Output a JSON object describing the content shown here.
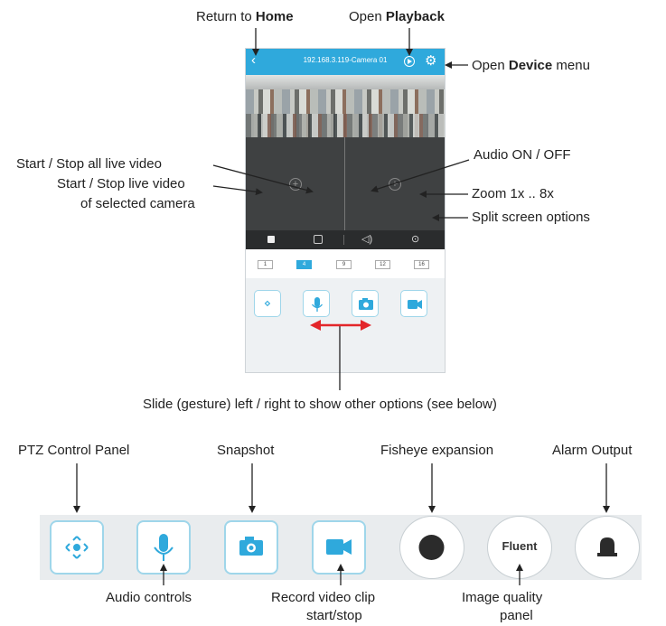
{
  "annotations": {
    "return_home_prefix": "Return to ",
    "return_home_bold": "Home",
    "open_playback_prefix": "Open ",
    "open_playback_bold": "Playback",
    "open_device_prefix": "Open ",
    "open_device_bold": "Device",
    "open_device_suffix": " menu",
    "start_stop_all": "Start / Stop all live video",
    "start_stop_selected_line1": "Start / Stop live video",
    "start_stop_selected_line2": "of selected camera",
    "audio_on_off": "Audio ON / OFF",
    "zoom": "Zoom 1x .. 8x",
    "split_options": "Split screen options",
    "slide_gesture": "Slide (gesture) left / right to show other options (see below)",
    "ptz_panel": "PTZ Control Panel",
    "snapshot": "Snapshot",
    "fisheye": "Fisheye expansion",
    "alarm_output": "Alarm Output",
    "audio_controls": "Audio controls",
    "record_line1": "Record video clip",
    "record_line2": "start/stop",
    "image_quality_line1": "Image quality",
    "image_quality_line2": "panel"
  },
  "phone": {
    "title": "192.168.3.119-Camera 01",
    "split_buttons": [
      "1",
      "4",
      "9",
      "12",
      "16"
    ],
    "active_split": "4"
  },
  "bottom_strip": {
    "fluent_label": "Fluent"
  },
  "colors": {
    "accent": "#2fa9dc",
    "arrow_red": "#e3262a"
  }
}
